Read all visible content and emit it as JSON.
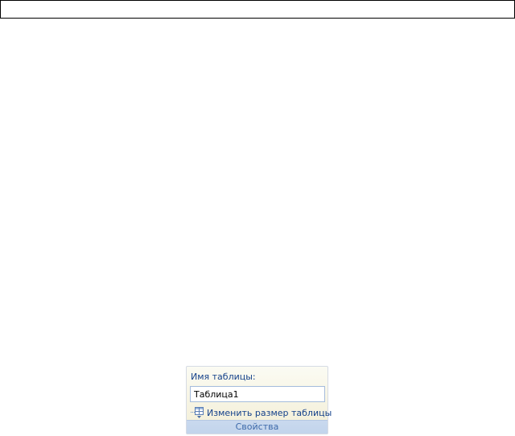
{
  "ribbon_group": {
    "name_label": "Имя таблицы:",
    "table_name_value": "Таблица1",
    "resize_button_label": "Изменить размер таблицы",
    "group_title": "Свойства",
    "resize_icon": "resize-table-icon"
  },
  "colors": {
    "label_text": "#15428b",
    "footer_text": "#3e6aaa",
    "input_border": "#a5bcdc",
    "footer_bg": "#c9d9ee"
  }
}
